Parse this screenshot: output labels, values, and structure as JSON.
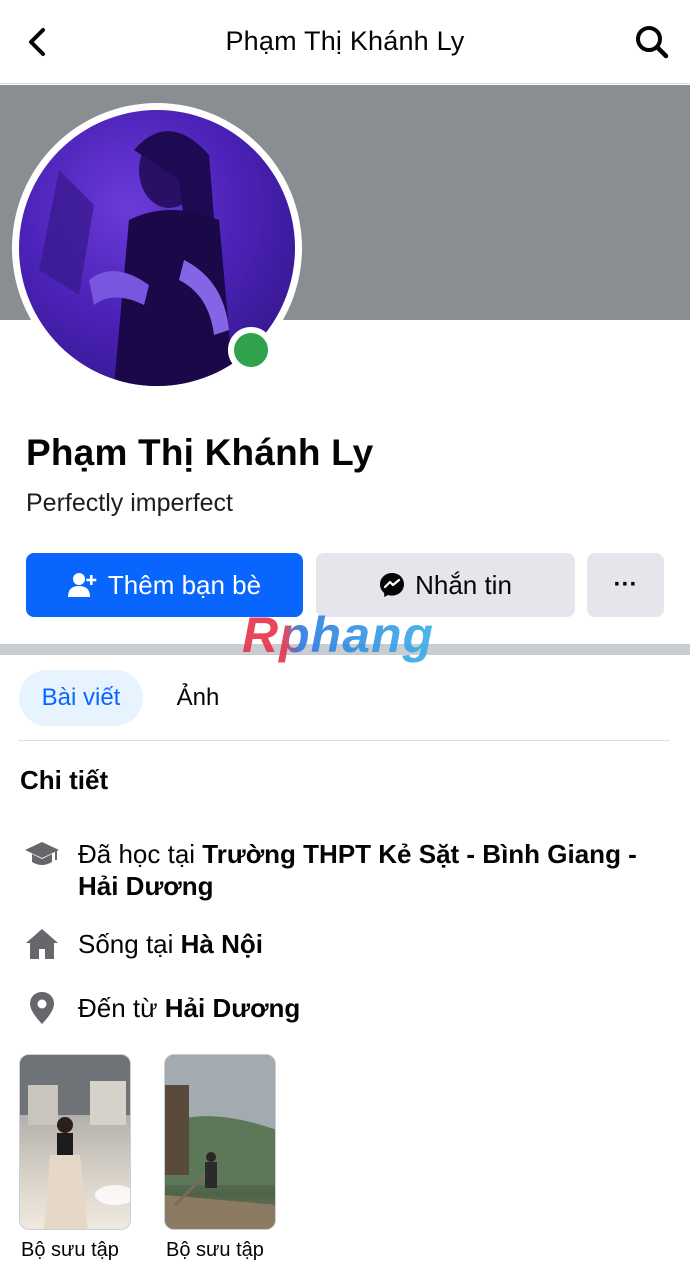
{
  "header": {
    "title": "Phạm Thị Khánh Ly",
    "back_icon": "chevron-left-icon",
    "search_icon": "search-icon"
  },
  "profile": {
    "name": "Phạm Thị Khánh Ly",
    "bio": "Perfectly imperfect",
    "online": true
  },
  "actions": {
    "add_friend": "Thêm bạn bè",
    "message": "Nhắn tin",
    "more": "···"
  },
  "watermark": "Rphang",
  "tabs": [
    {
      "label": "Bài viết",
      "active": true
    },
    {
      "label": "Ảnh",
      "active": false
    }
  ],
  "details": {
    "title": "Chi tiết",
    "items": [
      {
        "icon": "graduation-cap-icon",
        "prefix": "Đã học tại ",
        "value": "Trường THPT Kẻ Sặt - Bình Giang - Hải Dương"
      },
      {
        "icon": "home-icon",
        "prefix": "Sống tại ",
        "value": "Hà Nội"
      },
      {
        "icon": "location-pin-icon",
        "prefix": "Đến từ ",
        "value": "Hải Dương"
      }
    ]
  },
  "collections": [
    {
      "label": "Bộ sưu tập"
    },
    {
      "label": "Bộ sưu tập"
    }
  ],
  "colors": {
    "primary": "#0866ff",
    "secondary_button": "#e4e6eb",
    "online": "#31a24c",
    "cover": "#8a8d91"
  }
}
